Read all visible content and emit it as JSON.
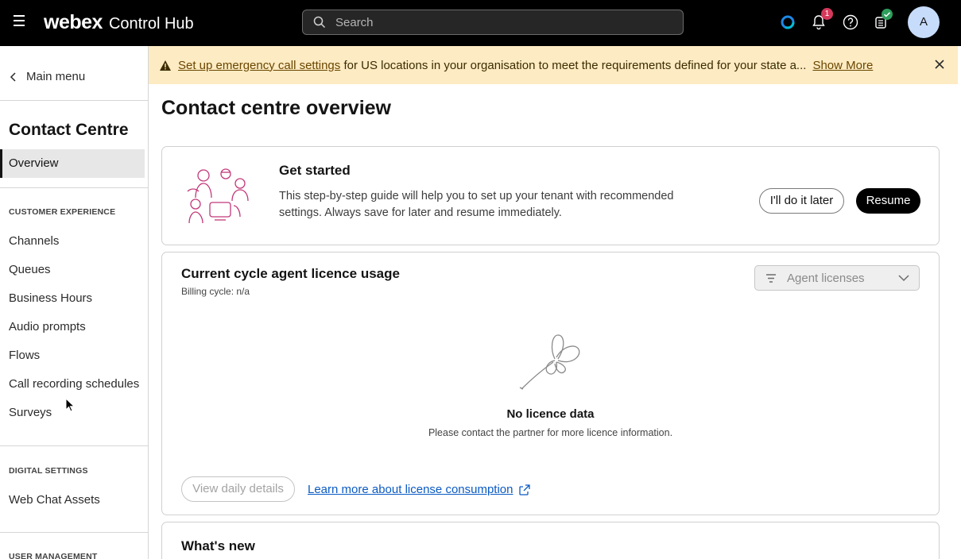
{
  "header": {
    "brand_main": "webex",
    "brand_sub": "Control Hub",
    "search_placeholder": "Search",
    "notification_count": "1",
    "avatar_initial": "A"
  },
  "sidebar": {
    "back_label": "Main menu",
    "title": "Contact Centre",
    "active_item": "Overview",
    "sections": [
      {
        "heading": "CUSTOMER EXPERIENCE",
        "items": [
          "Channels",
          "Queues",
          "Business Hours",
          "Audio prompts",
          "Flows",
          "Call recording schedules",
          "Surveys"
        ]
      },
      {
        "heading": "DIGITAL SETTINGS",
        "items": [
          "Web Chat Assets"
        ]
      },
      {
        "heading": "USER MANAGEMENT",
        "items": []
      }
    ]
  },
  "banner": {
    "link_text": "Set up emergency call settings",
    "message": " for US locations in your organisation to meet the requirements defined for your state a...",
    "show_more": "Show More"
  },
  "main": {
    "page_title": "Contact centre overview",
    "get_started": {
      "title": "Get started",
      "description": "This step-by-step guide will help you to set up your tenant with recommended settings. Always save for later and resume immediately.",
      "later_label": "I'll do it later",
      "resume_label": "Resume"
    },
    "licence_usage": {
      "title": "Current cycle agent licence usage",
      "billing": "Billing cycle: n/a",
      "dropdown_value": "Agent licenses",
      "empty_title": "No licence data",
      "empty_message": "Please contact the partner for more licence information.",
      "daily_button": "View daily details",
      "learn_link": "Learn more about license consumption"
    },
    "whats_new": {
      "title": "What's new"
    }
  },
  "colors": {
    "topbar": "#000000",
    "banner_bg": "#fdebc3",
    "link_blue": "#0b5ac3",
    "badge_red": "#d4395b",
    "status_green": "#2e9e5c",
    "illustration": "#c2387a"
  }
}
